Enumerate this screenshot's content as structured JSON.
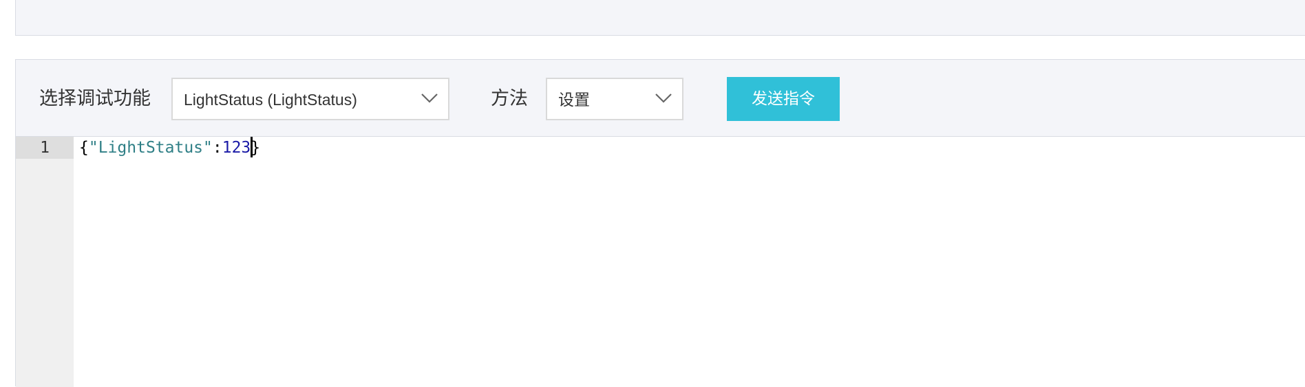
{
  "debug": {
    "function_label": "选择调试功能",
    "function_select": {
      "value": "LightStatus (LightStatus)"
    },
    "method_label": "方法",
    "method_select": {
      "value": "设置"
    },
    "send_button_label": "发送指令"
  },
  "editor": {
    "line_number": "1",
    "tokens": {
      "open_brace": "{",
      "key": "\"LightStatus\"",
      "colon": ":",
      "value": "123",
      "close_brace": "}"
    }
  },
  "colors": {
    "accent": "#30c0d8",
    "panel_background": "#f4f5f9",
    "json_key": "#2f7f86",
    "json_number": "#1a1aa6"
  },
  "icons": {
    "select_arrow": "chevron-down-icon"
  }
}
